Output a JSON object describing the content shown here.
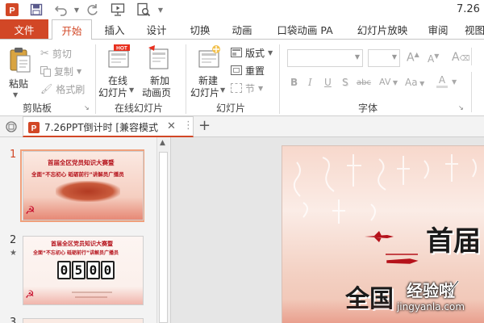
{
  "window": {
    "title_fragment": "7.26"
  },
  "colors": {
    "accent": "#d24726",
    "ribbon_bg": "#ffffff",
    "pane_bg": "#f3f3f3"
  },
  "quick_access": {
    "icons": [
      "powerpoint-app-icon",
      "save-icon",
      "undo-icon",
      "redo-icon",
      "presentation-from-start-icon",
      "print-preview-icon"
    ]
  },
  "tabs": [
    {
      "label": "文件"
    },
    {
      "label": "开始"
    },
    {
      "label": "插入"
    },
    {
      "label": "设计"
    },
    {
      "label": "切换"
    },
    {
      "label": "动画"
    },
    {
      "label": "口袋动画 PA"
    },
    {
      "label": "幻灯片放映"
    },
    {
      "label": "审阅"
    },
    {
      "label": "视图"
    }
  ],
  "ribbon": {
    "clipboard": {
      "paste": "粘贴",
      "cut": "剪切",
      "copy": "复制",
      "format_painter": "格式刷",
      "group": "剪贴板"
    },
    "online_slides": {
      "online_slide_line1": "在线",
      "online_slide_line2": "幻灯片",
      "hot_badge": "HOT",
      "new_page_line1": "新加",
      "new_page_line2": "动画页",
      "group": "在线幻灯片"
    },
    "slides": {
      "new_slide_line1": "新建",
      "new_slide_line2": "幻灯片",
      "layout": "版式",
      "reset": "重置",
      "section": "节",
      "group": "幻灯片"
    },
    "font": {
      "font_name_value": "",
      "font_size_value": "",
      "bold": "B",
      "italic": "I",
      "underline": "U",
      "shadow": "S",
      "strikethrough": "abc",
      "char_spacing": "AV",
      "change_case": "Aa",
      "grow": "A",
      "shrink": "A",
      "clear": "A",
      "group": "字体"
    }
  },
  "document_tab": {
    "title": "7.26PPT倒计时 [兼容模式"
  },
  "slides": [
    {
      "number": "1",
      "title": "首届全区党员知识大赛暨",
      "subtitle": "全面“不忘初心 砥砺前行”讲解员广播员",
      "selected": true
    },
    {
      "number": "2",
      "marker": "★",
      "title": "首届全区党员知识大赛暨",
      "subtitle": "全面“不忘初心 砥砺前行”讲解员广播员",
      "countdown": [
        "0",
        "5",
        "0",
        "0"
      ],
      "selected": false
    },
    {
      "number": "3",
      "selected": false
    }
  ],
  "canvas_slide": {
    "title_fragment": "首届",
    "subtitle_fragment": "全国"
  },
  "watermark": {
    "line1": "经验啦",
    "line2": "jingyanla.com"
  }
}
